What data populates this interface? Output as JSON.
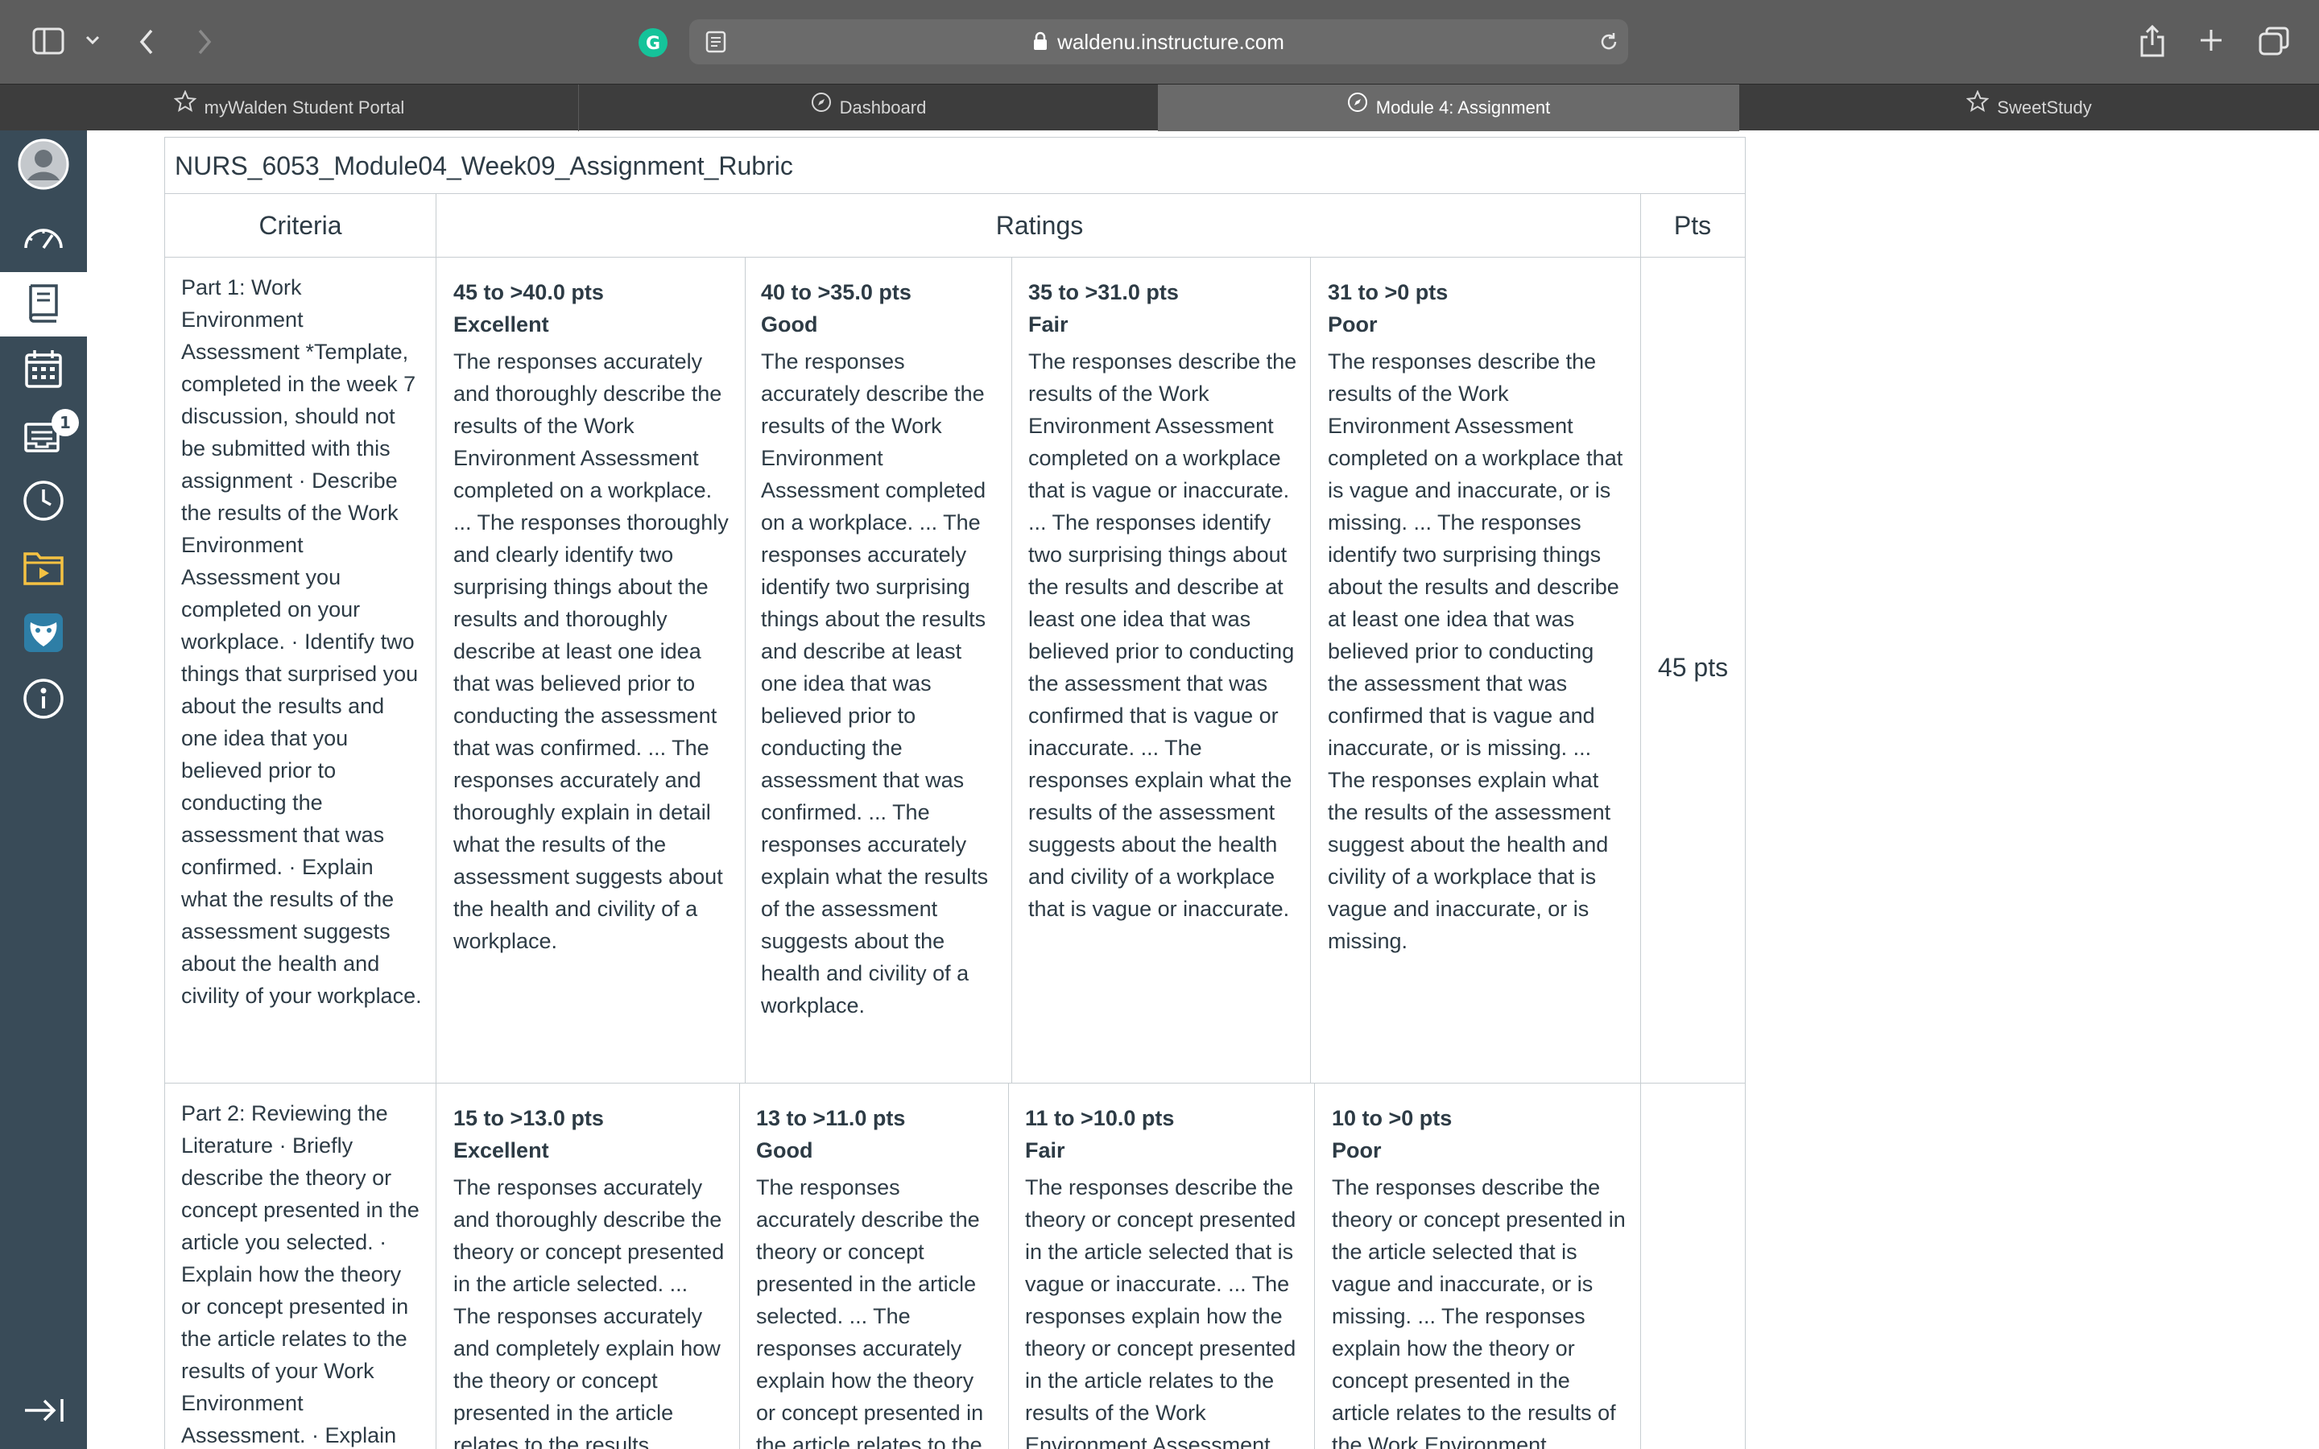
{
  "browser": {
    "address": "waldenu.instructure.com",
    "tabs": [
      {
        "label": "myWalden Student Portal",
        "icon": "star-icon",
        "active": false
      },
      {
        "label": "Dashboard",
        "icon": "compass-icon",
        "active": false
      },
      {
        "label": "Module 4: Assignment",
        "icon": "compass-icon",
        "active": true
      },
      {
        "label": "SweetStudy",
        "icon": "star-icon",
        "active": false
      }
    ],
    "grammarly_letter": "G"
  },
  "global_nav": {
    "items": [
      {
        "name": "account",
        "icon": "avatar-icon"
      },
      {
        "name": "dashboard",
        "icon": "speedometer-icon"
      },
      {
        "name": "courses",
        "icon": "book-icon",
        "active": true
      },
      {
        "name": "calendar",
        "icon": "calendar-icon"
      },
      {
        "name": "inbox",
        "icon": "inbox-icon",
        "badge": "1"
      },
      {
        "name": "history",
        "icon": "clock-icon"
      },
      {
        "name": "commons",
        "icon": "folder-play-icon"
      },
      {
        "name": "owl",
        "icon": "owl-icon"
      },
      {
        "name": "help",
        "icon": "info-icon"
      }
    ],
    "collapse_icon": "collapse-arrow-icon"
  },
  "rubric": {
    "title": "NURS_6053_Module04_Week09_Assignment_Rubric",
    "headers": {
      "criteria": "Criteria",
      "ratings": "Ratings",
      "pts": "Pts"
    },
    "rows": [
      {
        "criterion": "Part 1: Work Environment Assessment *Template, completed in the week 7 discussion, should not be submitted with this assignment · Describe the results of the Work Environment Assessment you completed on your workplace. · Identify two things that surprised you about the results and one idea that you believed prior to conducting the assessment that was confirmed. · Explain what the results of the assessment suggests about the health and civility of your workplace.",
        "points": "45 pts",
        "ratings": [
          {
            "range": "45 to >40.0 pts",
            "name": "Excellent",
            "description": "The responses accurately and thoroughly describe the results of the Work Environment Assessment completed on a workplace. ... The responses thoroughly and clearly identify two surprising things about the results and thoroughly describe at least one idea that was believed prior to conducting the assessment that was confirmed. ... The responses accurately and thoroughly explain in detail what the results of the assessment suggests about the health and civility of a workplace."
          },
          {
            "range": "40 to >35.0 pts",
            "name": "Good",
            "description": "The responses accurately describe the results of the Work Environment Assessment completed on a workplace. ... The responses accurately identify two surprising things about the results and describe at least one idea that was believed prior to conducting the assessment that was confirmed. ... The responses accurately explain what the results of the assessment suggests about the health and civility of a workplace."
          },
          {
            "range": "35 to >31.0 pts",
            "name": "Fair",
            "description": "The responses describe the results of the Work Environment Assessment completed on a workplace that is vague or inaccurate. ... The responses identify two surprising things about the results and describe at least one idea that was believed prior to conducting the assessment that was confirmed that is vague or inaccurate. ... The responses explain what the results of the assessment suggests about the health and civility of a workplace that is vague or inaccurate."
          },
          {
            "range": "31 to >0 pts",
            "name": "Poor",
            "description": "The responses describe the results of the Work Environment Assessment completed on a workplace that is vague and inaccurate, or is missing. ... The responses identify two surprising things about the results and describe at least one idea that was believed prior to conducting the assessment that was confirmed that is vague and inaccurate, or is missing. ... The responses explain what the results of the assessment suggest about the health and civility of a workplace that is vague and inaccurate, or is missing."
          }
        ]
      },
      {
        "criterion": "Part 2: Reviewing the Literature · Briefly describe the theory or concept presented in the article you selected. · Explain how the theory or concept presented in the article relates to the results of your Work Environment Assessment. · Explain",
        "points": "",
        "ratings": [
          {
            "range": "15 to >13.0 pts",
            "name": "Excellent",
            "description": "The responses accurately and thoroughly describe the theory or concept presented in the article selected. ... The responses accurately and completely explain how the theory or concept presented in the article relates to the results"
          },
          {
            "range": "13 to >11.0 pts",
            "name": "Good",
            "description": "The responses accurately describe the theory or concept presented in the article selected. ... The responses accurately explain how the theory or concept presented in the article relates to the"
          },
          {
            "range": "11 to >10.0 pts",
            "name": "Fair",
            "description": "The responses describe the theory or concept presented in the article selected that is vague or inaccurate. ... The responses explain how the theory or concept presented in the article relates to the results of the Work Environment Assessment"
          },
          {
            "range": "10 to >0 pts",
            "name": "Poor",
            "description": "The responses describe the theory or concept presented in the article selected that is vague and inaccurate, or is missing. ... The responses explain how the theory or concept presented in the article relates to the results of the Work Environment"
          }
        ]
      }
    ]
  }
}
